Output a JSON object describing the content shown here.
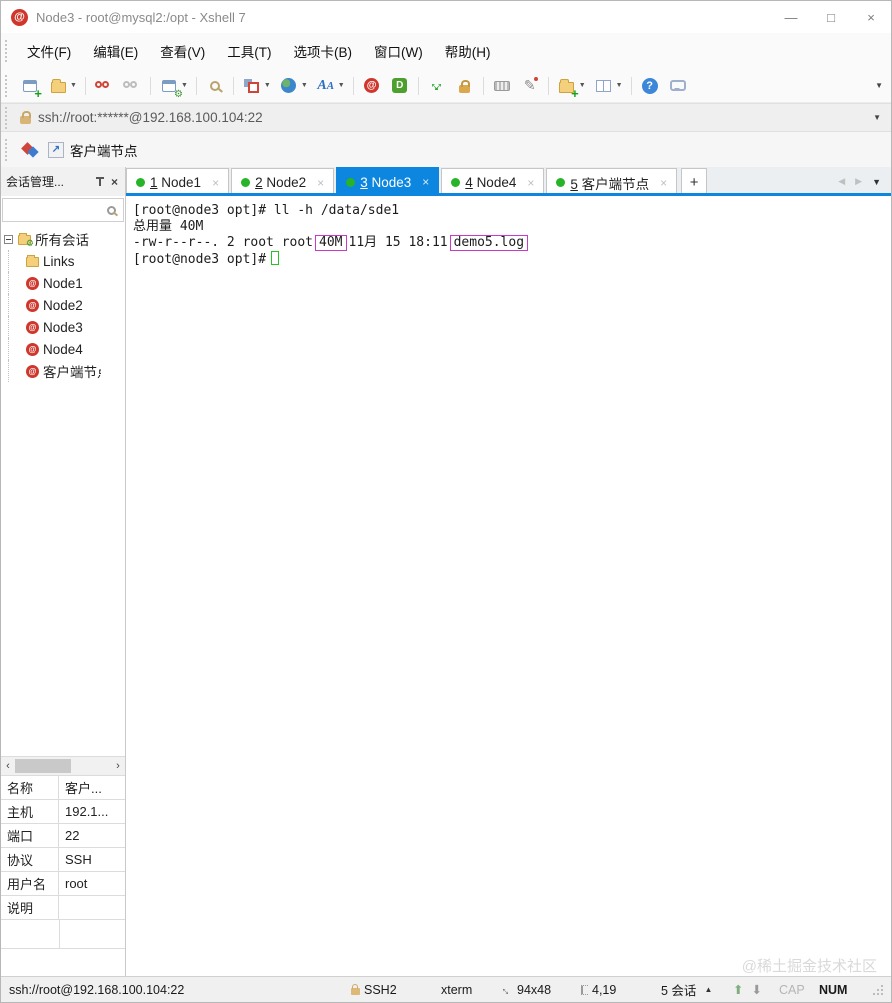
{
  "window": {
    "title": "Node3 - root@mysql2:/opt - Xshell 7",
    "minimize_glyph": "—",
    "maximize_glyph": "□",
    "close_glyph": "×"
  },
  "menu": {
    "items": [
      "文件(F)",
      "编辑(E)",
      "查看(V)",
      "工具(T)",
      "选项卡(B)",
      "窗口(W)",
      "帮助(H)"
    ]
  },
  "toolbar": {
    "icons": [
      "new-session",
      "open-sessions",
      "disconnect",
      "reconnect",
      "session-properties",
      "find",
      "arrange-windows",
      "web-browser",
      "select-font",
      "xshell-home",
      "xftp-transfer",
      "fullscreen",
      "lock-screen",
      "virtual-keyboard",
      "compose-pen",
      "new-session-folder",
      "layout-panes",
      "help",
      "feedback",
      "toolbar-overflow"
    ]
  },
  "address_bar": {
    "url": "ssh://root:******@192.168.100.104:22"
  },
  "quick_launch": {
    "session_label": "客户端节点"
  },
  "tabs": {
    "close_glyph": "×",
    "new_tab_label": "+",
    "items": [
      {
        "num": "1",
        "label": "Node1"
      },
      {
        "num": "2",
        "label": "Node2"
      },
      {
        "num": "3",
        "label": "Node3"
      },
      {
        "num": "4",
        "label": "Node4"
      },
      {
        "num": "5",
        "label": "客户端节点"
      }
    ]
  },
  "sidebar": {
    "header": {
      "title": "会话管理...",
      "close_glyph": "×"
    },
    "tree": {
      "root_label": "所有会话",
      "items": [
        "Links",
        "Node1",
        "Node2",
        "Node3",
        "Node4",
        "客户端节点"
      ]
    },
    "properties": [
      {
        "key": "名称",
        "value": "客户..."
      },
      {
        "key": "主机",
        "value": "192.1..."
      },
      {
        "key": "端口",
        "value": "22"
      },
      {
        "key": "协议",
        "value": "SSH"
      },
      {
        "key": "用户名",
        "value": "root"
      },
      {
        "key": "说明",
        "value": ""
      }
    ]
  },
  "terminal": {
    "line1": "[root@node3 opt]# ll -h /data/sde1",
    "line2": "总用量 40M",
    "line3_prefix": "-rw-r--r--. 2 root root",
    "line3_size": "40M",
    "line3_mid": "11月 15 18:11",
    "line3_file": "demo5.log",
    "line4_prompt": "[root@node3 opt]#",
    "watermark": "@稀土掘金技术社区",
    "highlight_color": "#c73bc7"
  },
  "status_bar": {
    "url": "ssh://root@192.168.100.104:22",
    "protocol": "SSH2",
    "terminal_type": "xterm",
    "screen_size": "94x48",
    "cursor_position": "4,19",
    "session_count": "5 会话",
    "caps_indicator": "CAP",
    "num_indicator": "NUM"
  },
  "colors": {
    "accent_blue": "#0c86df",
    "tab_dot_green": "#28b428",
    "highlight_box": "#c73bc7",
    "cursor_green": "#25c425"
  }
}
